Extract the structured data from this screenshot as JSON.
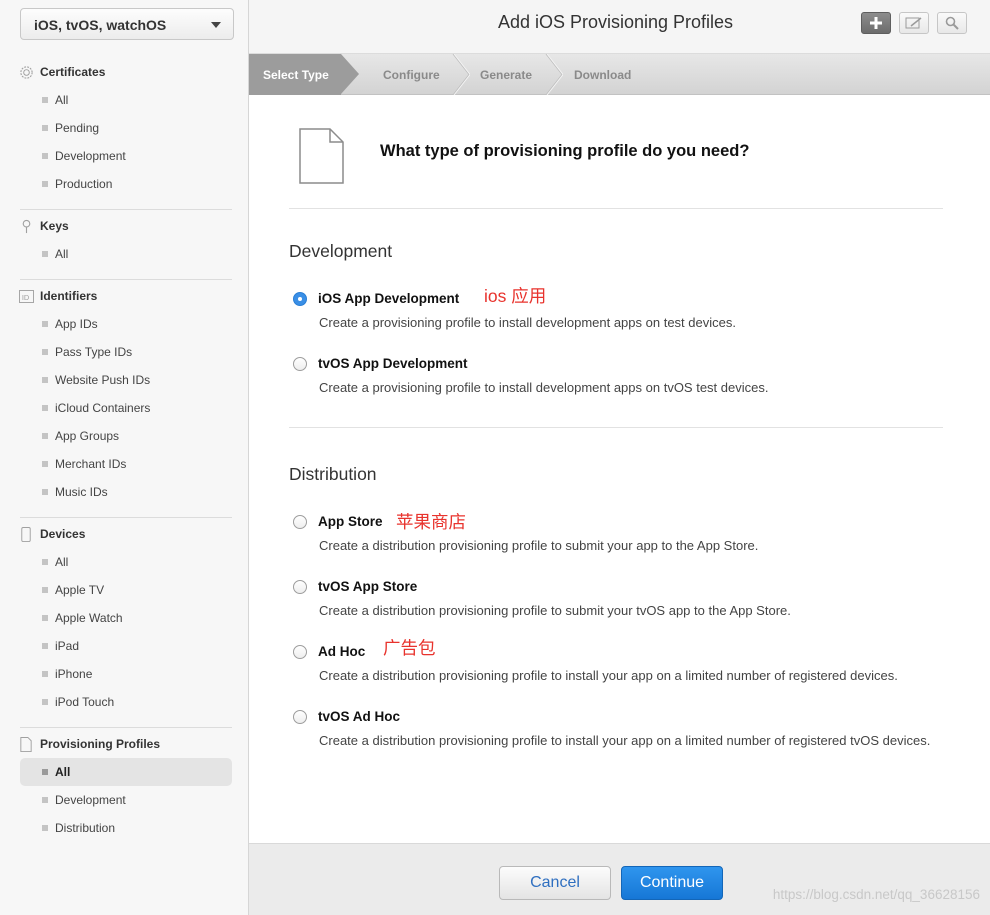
{
  "sidebar": {
    "platform": "iOS, tvOS, watchOS",
    "sections": [
      {
        "title": "Certificates",
        "icon": "certificate-icon",
        "items": [
          "All",
          "Pending",
          "Development",
          "Production"
        ]
      },
      {
        "title": "Keys",
        "icon": "key-icon",
        "items": [
          "All"
        ]
      },
      {
        "title": "Identifiers",
        "icon": "id-icon",
        "items": [
          "App IDs",
          "Pass Type IDs",
          "Website Push IDs",
          "iCloud Containers",
          "App Groups",
          "Merchant IDs",
          "Music IDs"
        ]
      },
      {
        "title": "Devices",
        "icon": "device-icon",
        "items": [
          "All",
          "Apple TV",
          "Apple Watch",
          "iPad",
          "iPhone",
          "iPod Touch"
        ]
      },
      {
        "title": "Provisioning Profiles",
        "icon": "document-icon",
        "items": [
          "All",
          "Development",
          "Distribution"
        ],
        "active_index": 0
      }
    ]
  },
  "header": {
    "title": "Add iOS Provisioning Profiles",
    "buttons": [
      "add-icon",
      "edit-icon",
      "search-icon"
    ]
  },
  "steps": [
    "Select Type",
    "Configure",
    "Generate",
    "Download"
  ],
  "content": {
    "question": "What type of provisioning profile do you need?",
    "development": {
      "title": "Development",
      "options": [
        {
          "label": "iOS App Development",
          "desc": "Create a provisioning profile to install development apps on test devices.",
          "checked": true,
          "annotation": "ios 应用"
        },
        {
          "label": "tvOS App Development",
          "desc": "Create a provisioning profile to install development apps on tvOS test devices.",
          "checked": false
        }
      ]
    },
    "distribution": {
      "title": "Distribution",
      "options": [
        {
          "label": "App Store",
          "desc": "Create a distribution provisioning profile to submit your app to the App Store.",
          "checked": false,
          "annotation": "苹果商店"
        },
        {
          "label": "tvOS App Store",
          "desc": "Create a distribution provisioning profile to submit your tvOS app to the App Store.",
          "checked": false
        },
        {
          "label": "Ad Hoc",
          "desc": "Create a distribution provisioning profile to install your app on a limited number of registered devices.",
          "checked": false,
          "annotation": "广告包"
        },
        {
          "label": "tvOS Ad Hoc",
          "desc": "Create a distribution provisioning profile to install your app on a limited number of registered tvOS devices.",
          "checked": false
        }
      ]
    }
  },
  "footer": {
    "cancel": "Cancel",
    "continue": "Continue",
    "watermark": "https://blog.csdn.net/qq_36628156"
  },
  "colors": {
    "accent": "#1b7fdf",
    "annotation": "#e8332d"
  }
}
